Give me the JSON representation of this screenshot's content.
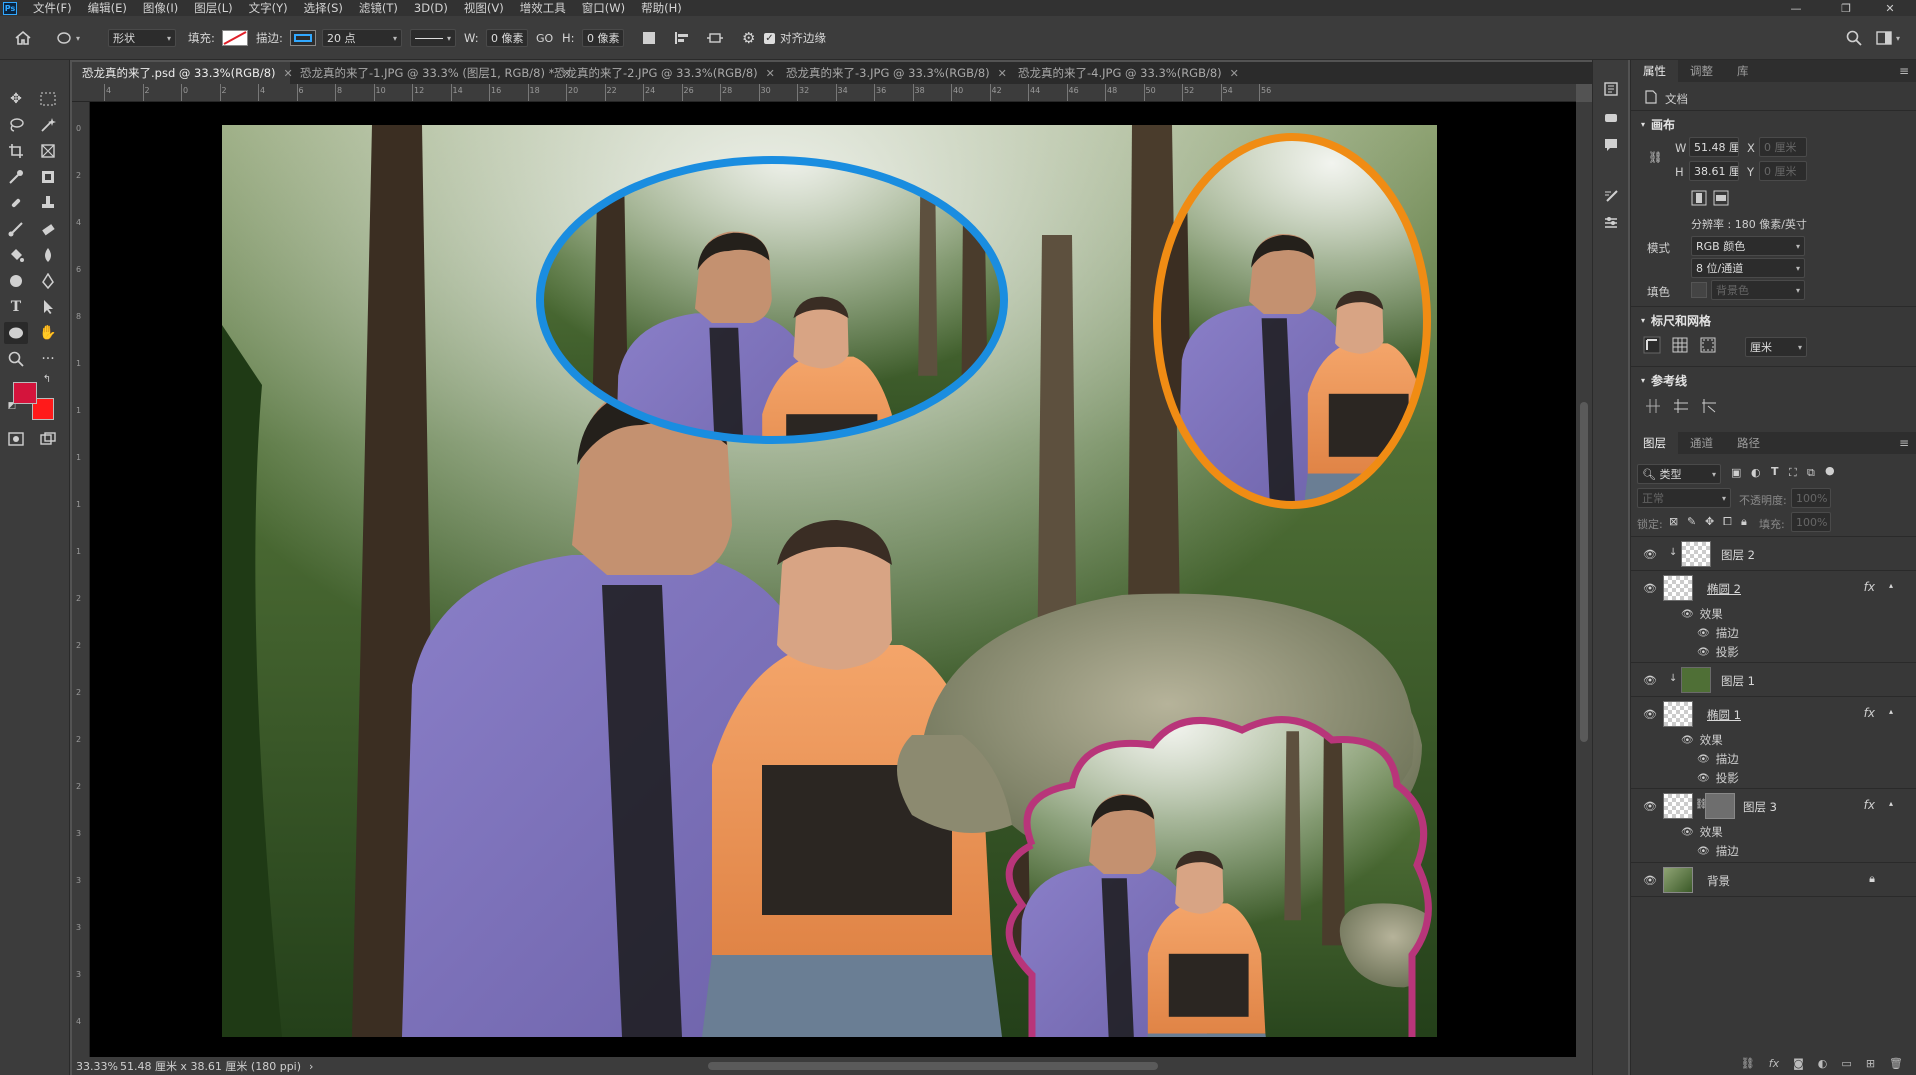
{
  "app": {
    "logo": "Ps"
  },
  "menu": [
    "文件(F)",
    "编辑(E)",
    "图像(I)",
    "图层(L)",
    "文字(Y)",
    "选择(S)",
    "滤镜(T)",
    "3D(D)",
    "视图(V)",
    "增效工具",
    "窗口(W)",
    "帮助(H)"
  ],
  "window_controls": {
    "minimize": "—",
    "restore": "❐",
    "close": "✕"
  },
  "options": {
    "mode_value": "形状",
    "fill_label": "填充:",
    "stroke_label": "描边:",
    "stroke_size": "20 点",
    "w_label": "W:",
    "w_value": "0 像素",
    "h_label": "H:",
    "h_value": "0 像素",
    "align_edges_label": "对齐边缘",
    "align_edges_checked": true
  },
  "tabs": [
    {
      "label": "恐龙真的来了.psd @ 33.3%(RGB/8)",
      "active": true
    },
    {
      "label": "恐龙真的来了-1.JPG @ 33.3% (图层1, RGB/8) *",
      "active": false
    },
    {
      "label": "恐龙真的来了-2.JPG @ 33.3%(RGB/8)",
      "active": false
    },
    {
      "label": "恐龙真的来了-3.JPG @ 33.3%(RGB/8)",
      "active": false
    },
    {
      "label": "恐龙真的来了-4.JPG @ 33.3%(RGB/8)",
      "active": false
    }
  ],
  "ruler": {
    "h_ticks": [
      "4",
      "2",
      "0",
      "2",
      "4",
      "6",
      "8",
      "10",
      "12",
      "14",
      "16",
      "18",
      "20",
      "22",
      "24",
      "26",
      "28",
      "30",
      "32",
      "34",
      "36",
      "38",
      "40",
      "42",
      "44",
      "46",
      "48",
      "50",
      "52",
      "54",
      "56"
    ],
    "v_ticks": [
      "0",
      "2",
      "4",
      "6",
      "8",
      "1",
      "1",
      "1",
      "1",
      "1",
      "2",
      "2",
      "2",
      "2",
      "2",
      "3",
      "3",
      "3",
      "3",
      "4"
    ]
  },
  "colors": {
    "foreground": "#d4143c",
    "background": "#ff1a1a",
    "accent": "#31a8ff"
  },
  "status": {
    "zoom": "33.33%",
    "info": "51.48 厘米 x 38.61 厘米 (180 ppi)",
    "arrow": "›"
  },
  "properties": {
    "tabs": [
      "属性",
      "调整",
      "库"
    ],
    "doc_label": "文档",
    "canvas_section": "画布",
    "w_label": "W",
    "w_value": "51.48 厘米",
    "h_label": "H",
    "h_value": "38.61 厘米",
    "x_label": "X",
    "x_value": "0 厘米",
    "y_label": "Y",
    "y_value": "0 厘米",
    "resolution": "分辨率 : 180 像素/英寸",
    "mode_label": "模式",
    "mode_value": "RGB 颜色",
    "depth_value": "8 位/通道",
    "fill_label": "填色",
    "fill_value": "背景色",
    "rulers_section": "标尺和网格",
    "unit_value": "厘米",
    "guides_section": "参考线"
  },
  "layers_panel": {
    "tabs": [
      "图层",
      "通道",
      "路径"
    ],
    "filter_value": "类型",
    "blend_mode": "正常",
    "opacity_label": "不透明度:",
    "opacity_value": "100%",
    "lock_label": "锁定:",
    "fill_label": "填充:",
    "fill_value": "100%",
    "fx_label": "fx",
    "effects_label": "效果",
    "stroke_effect": "描边",
    "shadow_effect": "投影",
    "layers": [
      {
        "name": "图层 2"
      },
      {
        "name": "椭圆 2"
      },
      {
        "name": "图层 1"
      },
      {
        "name": "椭圆 1"
      },
      {
        "name": "图层 3"
      },
      {
        "name": "背景"
      }
    ]
  }
}
